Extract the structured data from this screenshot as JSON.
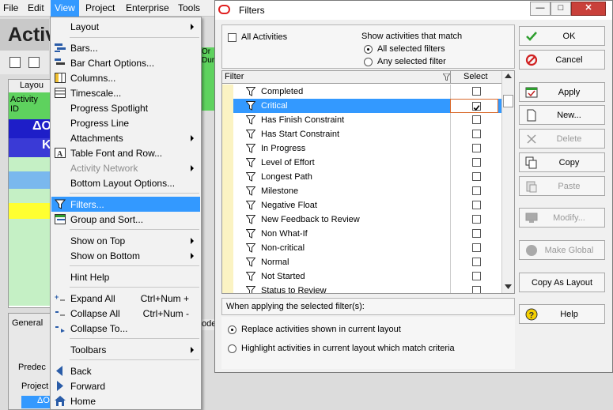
{
  "menubar": {
    "items": [
      {
        "label": "File",
        "active": false
      },
      {
        "label": "Edit",
        "active": false
      },
      {
        "label": "View",
        "active": true
      },
      {
        "label": "Project",
        "active": false
      },
      {
        "label": "Enterprise",
        "active": false
      },
      {
        "label": "Tools",
        "active": false
      }
    ]
  },
  "background": {
    "page_title": "Activ",
    "layout_tab": "Layou",
    "column_activity_id": "Activity ID",
    "column_or": "Or",
    "column_dur": "Dur",
    "group_row_label": "ΔO",
    "group_row_k": "K",
    "bottom_tab_general": "General",
    "bottom_tab_node": "ode",
    "predecessors_tab": "Predec",
    "project_col": "Project",
    "bottom_row": "ΔO"
  },
  "view_menu": {
    "items": [
      {
        "label": "Layout",
        "submenu": true,
        "disabled": false,
        "icon": "none"
      },
      {
        "label": "Bars...",
        "icon": "bars-icon"
      },
      {
        "label": "Bar Chart Options...",
        "icon": "bar-chart-options-icon"
      },
      {
        "label": "Columns...",
        "icon": "columns-icon"
      },
      {
        "label": "Timescale...",
        "icon": "timescale-icon"
      },
      {
        "label": "Progress Spotlight",
        "icon": "none"
      },
      {
        "label": "Progress Line",
        "icon": "none"
      },
      {
        "label": "Attachments",
        "submenu": true,
        "icon": "none"
      },
      {
        "label": "Table Font and Row...",
        "icon": "table-font-icon"
      },
      {
        "label": "Activity Network",
        "submenu": true,
        "disabled": true,
        "icon": "none"
      },
      {
        "label": "Bottom Layout Options...",
        "icon": "none"
      },
      {
        "label": "Filters...",
        "icon": "filter-icon",
        "highlighted": true
      },
      {
        "label": "Group and Sort...",
        "icon": "group-sort-icon"
      },
      {
        "label": "Show on Top",
        "submenu": true,
        "icon": "none"
      },
      {
        "label": "Show on Bottom",
        "submenu": true,
        "icon": "none"
      },
      {
        "label": "Hint Help",
        "icon": "none"
      },
      {
        "label": "Expand All",
        "shortcut": "Ctrl+Num +",
        "icon": "expand-all-icon"
      },
      {
        "label": "Collapse All",
        "shortcut": "Ctrl+Num -",
        "icon": "collapse-all-icon"
      },
      {
        "label": "Collapse To...",
        "icon": "collapse-to-icon"
      },
      {
        "label": "Toolbars",
        "submenu": true,
        "icon": "none"
      },
      {
        "label": "Back",
        "icon": "back-icon"
      },
      {
        "label": "Forward",
        "icon": "forward-icon"
      },
      {
        "label": "Home",
        "icon": "home-icon"
      }
    ]
  },
  "dialog": {
    "title": "Filters",
    "all_activities_label": "All Activities",
    "all_activities_checked": false,
    "match_heading": "Show activities that match",
    "match_all_label": "All selected filters",
    "match_any_label": "Any selected filter",
    "match_selected": "all",
    "grid_header_filter": "Filter",
    "grid_header_select": "Select",
    "filters": [
      {
        "name": "Completed",
        "checked": false
      },
      {
        "name": "Critical",
        "checked": true,
        "selected": true
      },
      {
        "name": "Has Finish Constraint",
        "checked": false
      },
      {
        "name": "Has Start Constraint",
        "checked": false
      },
      {
        "name": "In Progress",
        "checked": false
      },
      {
        "name": "Level of Effort",
        "checked": false
      },
      {
        "name": "Longest Path",
        "checked": false
      },
      {
        "name": "Milestone",
        "checked": false
      },
      {
        "name": "Negative Float",
        "checked": false
      },
      {
        "name": "New Feedback to Review",
        "checked": false
      },
      {
        "name": "Non What-If",
        "checked": false
      },
      {
        "name": "Non-critical",
        "checked": false
      },
      {
        "name": "Normal",
        "checked": false
      },
      {
        "name": "Not Started",
        "checked": false
      },
      {
        "name": "Status to Review",
        "checked": false
      }
    ],
    "apply_heading": "When applying the selected filter(s):",
    "replace_label": "Replace activities shown in current layout",
    "highlight_label": "Highlight activities in current layout which match criteria",
    "apply_mode": "replace",
    "buttons": {
      "ok": "OK",
      "cancel": "Cancel",
      "apply": "Apply",
      "new": "New...",
      "delete": "Delete",
      "copy": "Copy",
      "paste": "Paste",
      "modify": "Modify...",
      "make_global": "Make Global",
      "copy_as_layout": "Copy As Layout",
      "help": "Help"
    },
    "window_buttons": {
      "minimize": "—",
      "maximize": "□",
      "close": "✕"
    }
  },
  "colors": {
    "menu_highlight": "#3399ff",
    "row_stripe": "#fbf3c3",
    "close_red": "#c9403a",
    "ok_green": "#2e9e2e",
    "cancel_red": "#d02020"
  }
}
